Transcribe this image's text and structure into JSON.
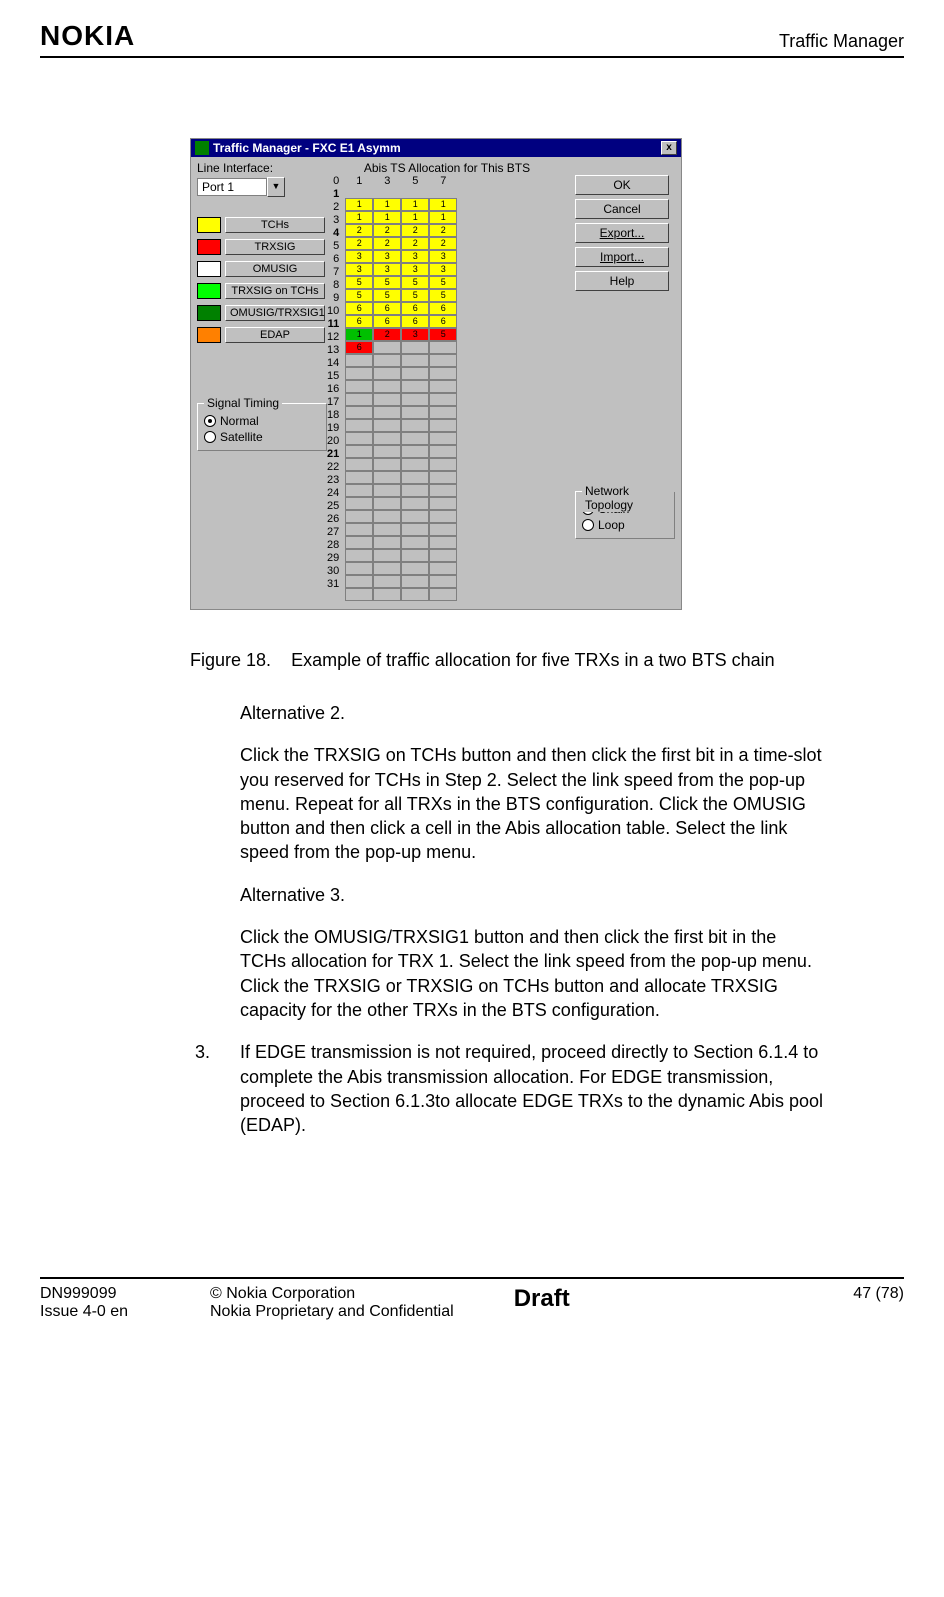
{
  "header": {
    "logo": "NOKIA",
    "section": "Traffic Manager"
  },
  "dialog": {
    "title": "Traffic Manager - FXC E1 Asymm",
    "abis_title": "Abis TS Allocation for This BTS",
    "line_interface_label": "Line Interface:",
    "line_interface_value": "Port 1",
    "col_headers": [
      "1",
      "3",
      "5",
      "7"
    ],
    "row_labels": [
      "0",
      "1",
      "2",
      "3",
      "4",
      "5",
      "6",
      "7",
      "8",
      "9",
      "10",
      "11",
      "12",
      "13",
      "14",
      "15",
      "16",
      "17",
      "18",
      "19",
      "20",
      "21",
      "22",
      "23",
      "24",
      "25",
      "26",
      "27",
      "28",
      "29",
      "30",
      "31"
    ],
    "bold_rows": [
      1,
      4,
      11,
      21
    ],
    "cells": {
      "1": {
        "c": [
          "1",
          "1",
          "1",
          "1"
        ],
        "cls": "y"
      },
      "2": {
        "c": [
          "1",
          "1",
          "1",
          "1"
        ],
        "cls": "y"
      },
      "3": {
        "c": [
          "2",
          "2",
          "2",
          "2"
        ],
        "cls": "y"
      },
      "4": {
        "c": [
          "2",
          "2",
          "2",
          "2"
        ],
        "cls": "y"
      },
      "5": {
        "c": [
          "3",
          "3",
          "3",
          "3"
        ],
        "cls": "y"
      },
      "6": {
        "c": [
          "3",
          "3",
          "3",
          "3"
        ],
        "cls": "y"
      },
      "7": {
        "c": [
          "5",
          "5",
          "5",
          "5"
        ],
        "cls": "y"
      },
      "8": {
        "c": [
          "5",
          "5",
          "5",
          "5"
        ],
        "cls": "y"
      },
      "9": {
        "c": [
          "6",
          "6",
          "6",
          "6"
        ],
        "cls": "y"
      },
      "10": {
        "c": [
          "6",
          "6",
          "6",
          "6"
        ],
        "cls": "y"
      },
      "11": {
        "c": [
          "1",
          "2",
          "3",
          "5"
        ],
        "cls": "r",
        "cls0": "g"
      },
      "12": {
        "c": [
          "6",
          "",
          "",
          ""
        ],
        "cls": "",
        "cls0": "r"
      }
    },
    "legend": [
      {
        "color": "#ffff00",
        "label": "TCHs"
      },
      {
        "color": "#ff0000",
        "label": "TRXSIG"
      },
      {
        "color": "#ffffff",
        "label": "OMUSIG"
      },
      {
        "color": "#00ff00",
        "label": "TRXSIG on TCHs"
      },
      {
        "color": "#008000",
        "label": "OMUSIG/TRXSIG1"
      },
      {
        "color": "#ff8000",
        "label": "EDAP"
      }
    ],
    "buttons": {
      "ok": "OK",
      "cancel": "Cancel",
      "export": "Export...",
      "import": "Import...",
      "help": "Help"
    },
    "signal_timing": {
      "title": "Signal Timing",
      "opt1": "Normal",
      "opt2": "Satellite"
    },
    "network_topology": {
      "title": "Network Topology",
      "opt1": "Chain",
      "opt2": "Loop"
    }
  },
  "caption": {
    "fig_label": "Figure 18.",
    "fig_text": "Example of traffic allocation for five TRXs in a two BTS chain"
  },
  "body": {
    "alt2_title": "Alternative 2.",
    "alt2_text": "Click the TRXSIG on TCHs button and then click the first bit in a time-slot you reserved for TCHs in Step 2. Select the link speed from the pop-up menu. Repeat for all TRXs in the BTS configuration. Click the OMUSIG button and then click a cell in the Abis allocation table. Select the link speed from the pop-up menu.",
    "alt3_title": "Alternative 3.",
    "alt3_text": "Click the OMUSIG/TRXSIG1 button and then click the first bit in the TCHs allocation for TRX 1. Select the link speed from the pop-up menu. Click the TRXSIG or TRXSIG on TCHs button and allocate TRXSIG capacity for the other TRXs in the BTS configuration.",
    "step3_num": "3.",
    "step3_text": "If EDGE transmission is not required, proceed directly to Section 6.1.4 to complete the Abis transmission allocation. For EDGE transmission, proceed to Section 6.1.3to allocate EDGE TRXs to the dynamic Abis pool (EDAP)."
  },
  "footer": {
    "doc_id": "DN999099",
    "issue": "Issue 4-0 en",
    "copyright": "© Nokia Corporation",
    "confidential": "Nokia Proprietary and Confidential",
    "draft": "Draft",
    "page": "47 (78)"
  }
}
